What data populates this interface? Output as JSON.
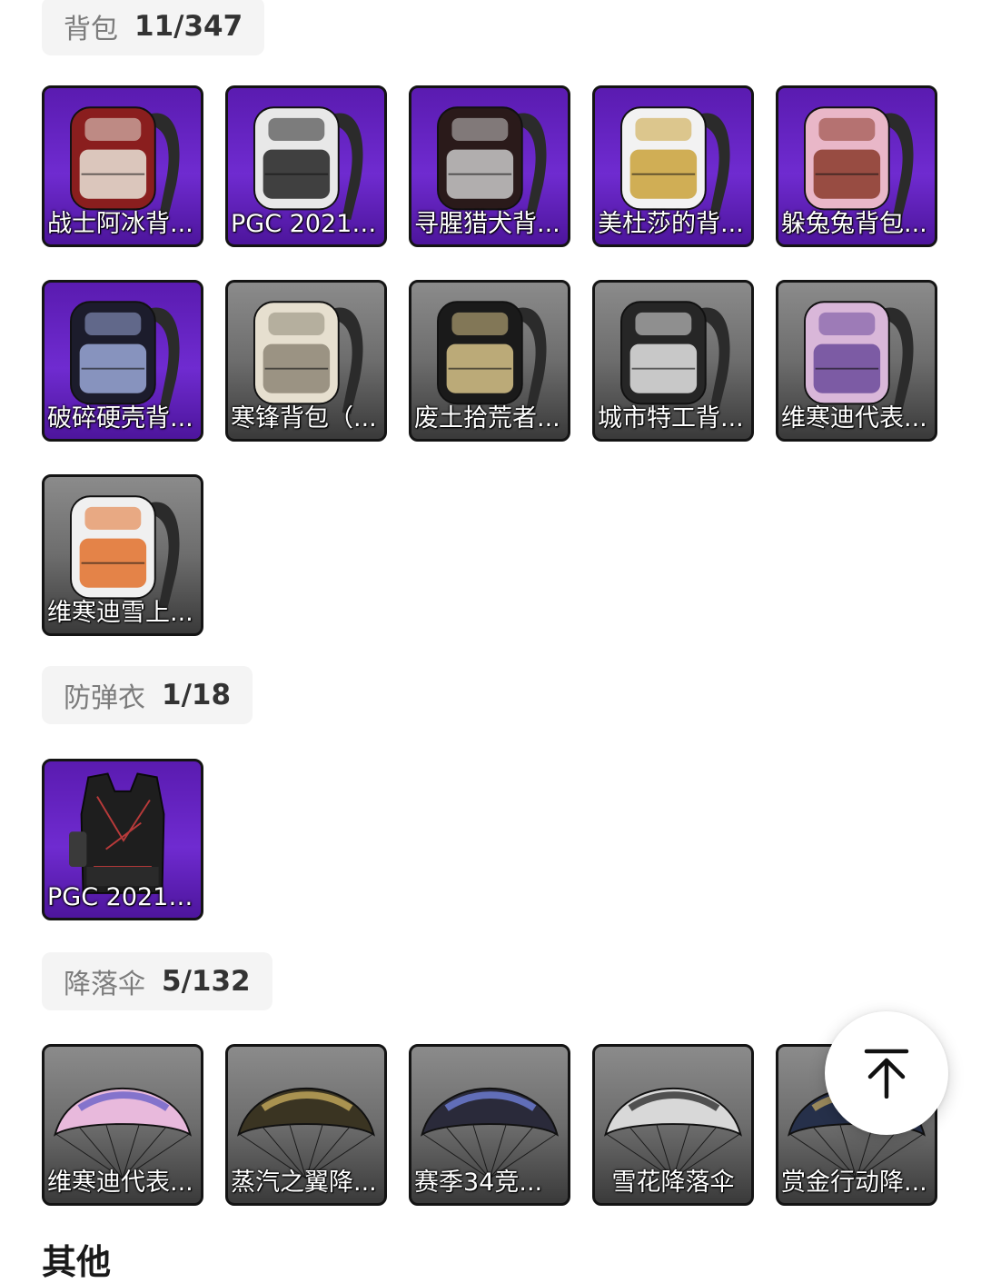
{
  "sections": [
    {
      "name": "背包",
      "count": "11/347",
      "items": [
        {
          "label": "战士阿冰背...",
          "bg": "purple",
          "icon": "backpack-icon",
          "colors": [
            "#8a1e1e",
            "#e9e4d8"
          ]
        },
        {
          "label": "PGC 2021 ...",
          "bg": "purple",
          "icon": "backpack-icon",
          "colors": [
            "#e8e8e8",
            "#222222"
          ]
        },
        {
          "label": "寻腥猎犬背...",
          "bg": "purple",
          "icon": "backpack-icon",
          "colors": [
            "#2a1a1a",
            "#c9c9c9"
          ]
        },
        {
          "label": "美杜莎的背...",
          "bg": "purple",
          "icon": "backpack-icon",
          "colors": [
            "#f2f2f2",
            "#caa23a"
          ]
        },
        {
          "label": "躲兔兔背包...",
          "bg": "purple",
          "icon": "backpack-icon",
          "colors": [
            "#e9b7c8",
            "#8a3a2a"
          ]
        },
        {
          "label": "破碎硬壳背...",
          "bg": "purple",
          "icon": "backpack-icon",
          "colors": [
            "#1c1c2c",
            "#9aa8d8"
          ]
        },
        {
          "label": "寒锋背包（...",
          "bg": "gray",
          "icon": "backpack-icon",
          "colors": [
            "#e6dfcf",
            "#8d8676"
          ]
        },
        {
          "label": "废土拾荒者...",
          "bg": "gray",
          "icon": "backpack-icon",
          "colors": [
            "#1a1a1a",
            "#d8c48a"
          ]
        },
        {
          "label": "城市特工背...",
          "bg": "gray",
          "icon": "backpack-icon",
          "colors": [
            "#262626",
            "#e5e5e5"
          ]
        },
        {
          "label": "维寒迪代表...",
          "bg": "gray",
          "icon": "backpack-icon",
          "colors": [
            "#d9b7d9",
            "#6b4b9a"
          ]
        },
        {
          "label": "维寒迪雪上...",
          "bg": "gray",
          "icon": "backpack-icon",
          "colors": [
            "#f0f0f0",
            "#e2702a"
          ]
        }
      ]
    },
    {
      "name": "防弹衣",
      "count": "1/18",
      "items": [
        {
          "label": "PGC 2021 ...",
          "bg": "purple",
          "icon": "vest-icon",
          "colors": [
            "#1e1e1e",
            "#b83a3a"
          ]
        }
      ]
    },
    {
      "name": "降落伞",
      "count": "5/132",
      "items": [
        {
          "label": "维寒迪代表...",
          "bg": "gray",
          "icon": "parachute-icon",
          "colors": [
            "#e8b9dc",
            "#6a62c8"
          ]
        },
        {
          "label": "蒸汽之翼降...",
          "bg": "gray",
          "icon": "parachute-icon",
          "colors": [
            "#3a3422",
            "#c6aa5c"
          ]
        },
        {
          "label": "赛季34竞...",
          "bg": "gray",
          "icon": "parachute-icon",
          "colors": [
            "#2a2a3a",
            "#6f7fd8"
          ]
        },
        {
          "label": "雪花降落伞",
          "bg": "gray",
          "icon": "parachute-icon",
          "colors": [
            "#d8d8d8",
            "#2e2e2e"
          ]
        },
        {
          "label": "赏金行动降...",
          "bg": "gray",
          "icon": "parachute-icon",
          "colors": [
            "#26304a",
            "#b8a060"
          ]
        }
      ]
    }
  ],
  "other_heading": "其他",
  "back_to_top": {
    "icon": "arrow-up-to-top-icon"
  }
}
